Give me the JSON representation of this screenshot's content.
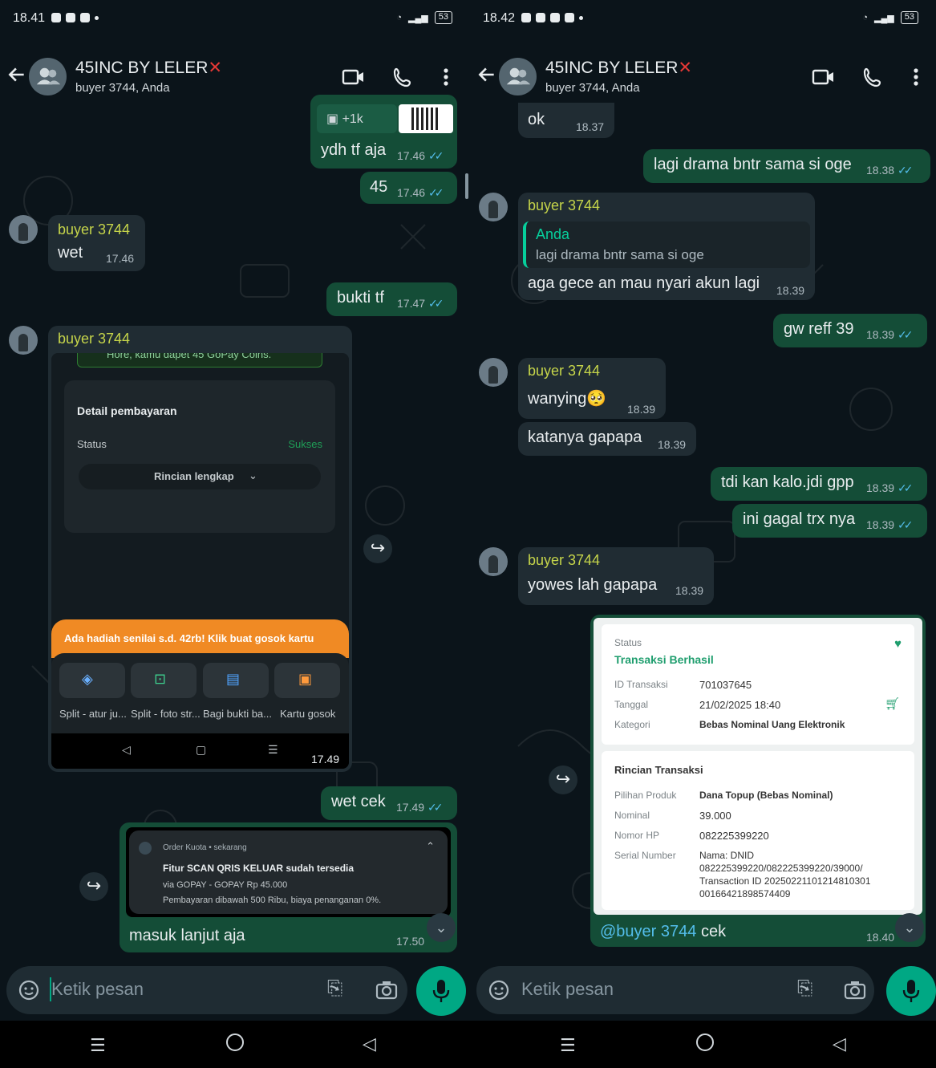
{
  "left": {
    "status": {
      "time": "18.41",
      "battery": "53"
    },
    "header": {
      "title": "45INC BY LELER",
      "title_mark": "✕",
      "subtitle": "buyer 3744, Anda"
    },
    "messages": {
      "img_count": "+1k",
      "m1_text": "ydh tf aja",
      "m1_time": "17.46",
      "m2_text": "45",
      "m2_time": "17.46",
      "m3_sender": "buyer 3744",
      "m3_text": "wet",
      "m3_time": "17.46",
      "m4_text": "bukti tf",
      "m4_time": "17.47",
      "m5_sender": "buyer 3744",
      "m5_time": "17.49",
      "m6_text": "wet cek",
      "m6_time": "17.49",
      "m7_text": "masuk lanjut aja",
      "m7_time": "17.50"
    },
    "receipt": {
      "banner_top": "Hore, kamu dapet 45 GoPay Coins.",
      "heading": "Detail pembayaran",
      "status_label": "Status",
      "status_value": "Sukses",
      "details_button": "Rincian lengkap",
      "promo": "Ada hadiah senilai s.d. 42rb! Klik buat gosok kartu",
      "actions": [
        "Split - atur ju...",
        "Split - foto str...",
        "Bagi bukti ba...",
        "Kartu gosok"
      ]
    },
    "notif": {
      "app": "Order Kuota",
      "when": "sekarang",
      "title": "Fitur SCAN QRIS KELUAR sudah tersedia",
      "line1": "via GOPAY - GOPAY Rp 45.000",
      "line2": "Pembayaran dibawah 500 Ribu, biaya penanganan 0%."
    },
    "input_placeholder": "Ketik pesan"
  },
  "right": {
    "status": {
      "time": "18.42",
      "battery": "53"
    },
    "header": {
      "title": "45INC BY LELER",
      "title_mark": "✕",
      "subtitle": "buyer 3744, Anda"
    },
    "messages": {
      "r1_text": "ok",
      "r1_time": "18.37",
      "r2_text": "lagi drama bntr sama si oge",
      "r2_time": "18.38",
      "r3_sender": "buyer 3744",
      "r3_quote_author": "Anda",
      "r3_quote_text": "lagi drama bntr sama si oge",
      "r3_text": "aga gece an mau nyari akun lagi",
      "r3_time": "18.39",
      "r4_text": "gw reff 39",
      "r4_time": "18.39",
      "r5_sender": "buyer 3744",
      "r5_text": "wanying🥺",
      "r5_time": "18.39",
      "r6_text": "katanya gapapa",
      "r6_time": "18.39",
      "r7_text": "tdi kan kalo.jdi gpp",
      "r7_time": "18.39",
      "r8_text": "ini gagal trx nya",
      "r8_time": "18.39",
      "r9_sender": "buyer 3744",
      "r9_text": "yowes lah gapapa",
      "r9_time": "18.39",
      "r10_mention": "@buyer 3744",
      "r10_text": " cek",
      "r10_time": "18.40"
    },
    "trx": {
      "status_label": "Status",
      "status_value": "Transaksi Berhasil",
      "rows1": [
        {
          "k": "ID Transaksi",
          "v": "701037645"
        },
        {
          "k": "Tanggal",
          "v": "21/02/2025 18:40"
        },
        {
          "k": "Kategori",
          "v": "Bebas Nominal Uang Elektronik"
        }
      ],
      "heading2": "Rincian Transaksi",
      "rows2": [
        {
          "k": "Pilihan Produk",
          "v": "Dana Topup (Bebas Nominal)"
        },
        {
          "k": "Nominal",
          "v": "39.000"
        },
        {
          "k": "Nomor HP",
          "v": "082225399220"
        },
        {
          "k": "Serial Number",
          "v": "Nama: DNID"
        }
      ],
      "serial_more": [
        "082225399220/082225399220/39000/",
        "Transaction ID 20250221101214810301",
        "00166421898574409"
      ]
    },
    "input_placeholder": "Ketik pesan"
  }
}
